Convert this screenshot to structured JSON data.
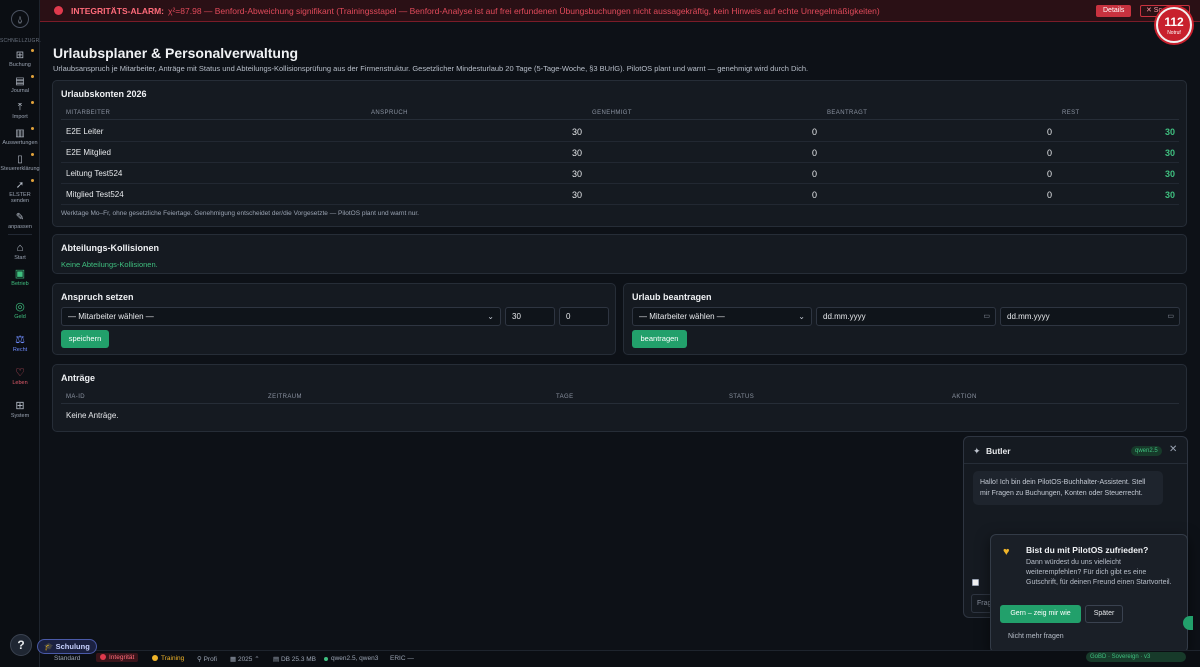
{
  "alarm": {
    "title": "INTEGRITÄTS-ALARM:",
    "text": "χ²=87.98 — Benford-Abweichung signifikant (Trainingsstapel — Benford-Analyse ist auf frei erfundenen Übungsbuchungen nicht aussagekräftig, kein Hinweis auf echte Unregelmäßigkeiten)",
    "details_label": "Details",
    "close_label": "✕ Sc..."
  },
  "notruf": {
    "number": "112",
    "label": "Notruf"
  },
  "sidebar": {
    "quick_label": "SCHNELLZUGR.",
    "items": [
      {
        "label": "Buchung",
        "icon": "grid-plus-icon"
      },
      {
        "label": "Journal",
        "icon": "journal-icon"
      },
      {
        "label": "Import",
        "icon": "upload-icon"
      },
      {
        "label": "Auswertungen",
        "icon": "chart-icon"
      },
      {
        "label": "Steuererklärung",
        "icon": "document-icon"
      },
      {
        "label": "ELSTER senden",
        "icon": "send-icon"
      },
      {
        "label": "anpassen",
        "icon": "pencil-icon"
      }
    ],
    "categories": [
      {
        "label": "Start",
        "icon": "home-icon"
      },
      {
        "label": "Betrieb",
        "icon": "briefcase-icon"
      },
      {
        "label": "Geld",
        "icon": "coins-icon"
      },
      {
        "label": "Recht",
        "icon": "scales-icon"
      },
      {
        "label": "Leben",
        "icon": "heart-icon"
      },
      {
        "label": "System",
        "icon": "apps-icon"
      }
    ],
    "help_label": "?"
  },
  "page": {
    "title": "Urlaubsplaner & Personalverwaltung",
    "subtitle": "Urlaubsanspruch je Mitarbeiter, Anträge mit Status und Abteilungs-Kollisionsprüfung aus der Firmenstruktur. Gesetzlicher Mindesturlaub 20 Tage (5-Tage-Woche, §3 BUrlG). PilotOS plant und warnt — genehmigt wird durch Dich."
  },
  "accounts": {
    "title": "Urlaubskonten 2026",
    "columns": [
      "MITARBEITER",
      "ANSPRUCH",
      "GENEHMIGT",
      "BEANTRAGT",
      "REST"
    ],
    "rows": [
      {
        "name": "E2E Leiter",
        "anspruch": "30",
        "genehmigt": "0",
        "beantragt": "0",
        "rest": "30"
      },
      {
        "name": "E2E Mitglied",
        "anspruch": "30",
        "genehmigt": "0",
        "beantragt": "0",
        "rest": "30"
      },
      {
        "name": "Leitung Test524",
        "anspruch": "30",
        "genehmigt": "0",
        "beantragt": "0",
        "rest": "30"
      },
      {
        "name": "Mitglied Test524",
        "anspruch": "30",
        "genehmigt": "0",
        "beantragt": "0",
        "rest": "30"
      }
    ],
    "note": "Werktage Mo–Fr, ohne gesetzliche Feiertage. Genehmigung entscheidet der/die Vorgesetzte — PilotOS plant und warnt nur."
  },
  "collisions": {
    "title": "Abteilungs-Kollisionen",
    "status": "Keine Abteilungs-Kollisionen."
  },
  "entitlement": {
    "title": "Anspruch setzen",
    "select_value": "— Mitarbeiter wählen —",
    "days_value": "30",
    "carry_value": "0",
    "save_label": "speichern"
  },
  "request": {
    "title": "Urlaub beantragen",
    "select_value": "— Mitarbeiter wählen —",
    "from_placeholder": "dd.mm.yyyy",
    "to_placeholder": "dd.mm.yyyy",
    "submit_label": "beantragen"
  },
  "requests": {
    "title": "Anträge",
    "columns": [
      "MA-ID",
      "ZEITRAUM",
      "TAGE",
      "STATUS",
      "AKTION"
    ],
    "empty": "Keine Anträge."
  },
  "butler": {
    "title": "Butler",
    "model_badge": "qwen2.5",
    "close_label": "✕",
    "message": "Hallo! Ich bin dein PilotOS-Buchhalter-Assistent. Stell mir Fragen zu Buchungen, Konten oder Steuerrecht.",
    "input_partial": "Frag"
  },
  "survey": {
    "title": "Bist du mit PilotOS zufrieden?",
    "text": "Dann würdest du uns vielleicht weiterempfehlen? Für dich gibt es eine Gutschrift, für deinen Freund einen Startvorteil.",
    "yes_label": "Gern – zeig mir wie",
    "later_label": "Später",
    "never_label": "Nicht mehr fragen"
  },
  "statusbar": {
    "mode": "Standard",
    "integrity": "Integrität",
    "training": "Training",
    "profile": "Profi",
    "year": "2025 ⌃",
    "db": "DB 25.3 MB",
    "models": "qwen2.5, qwen3",
    "eric": "ERIC —",
    "schulung": "Schulung",
    "right": "GoBD · Sovereign · v3"
  },
  "colors": {
    "accent_green": "#22a06b",
    "alarm_red": "#e03a4d",
    "rest_green": "#3fbf7f"
  }
}
